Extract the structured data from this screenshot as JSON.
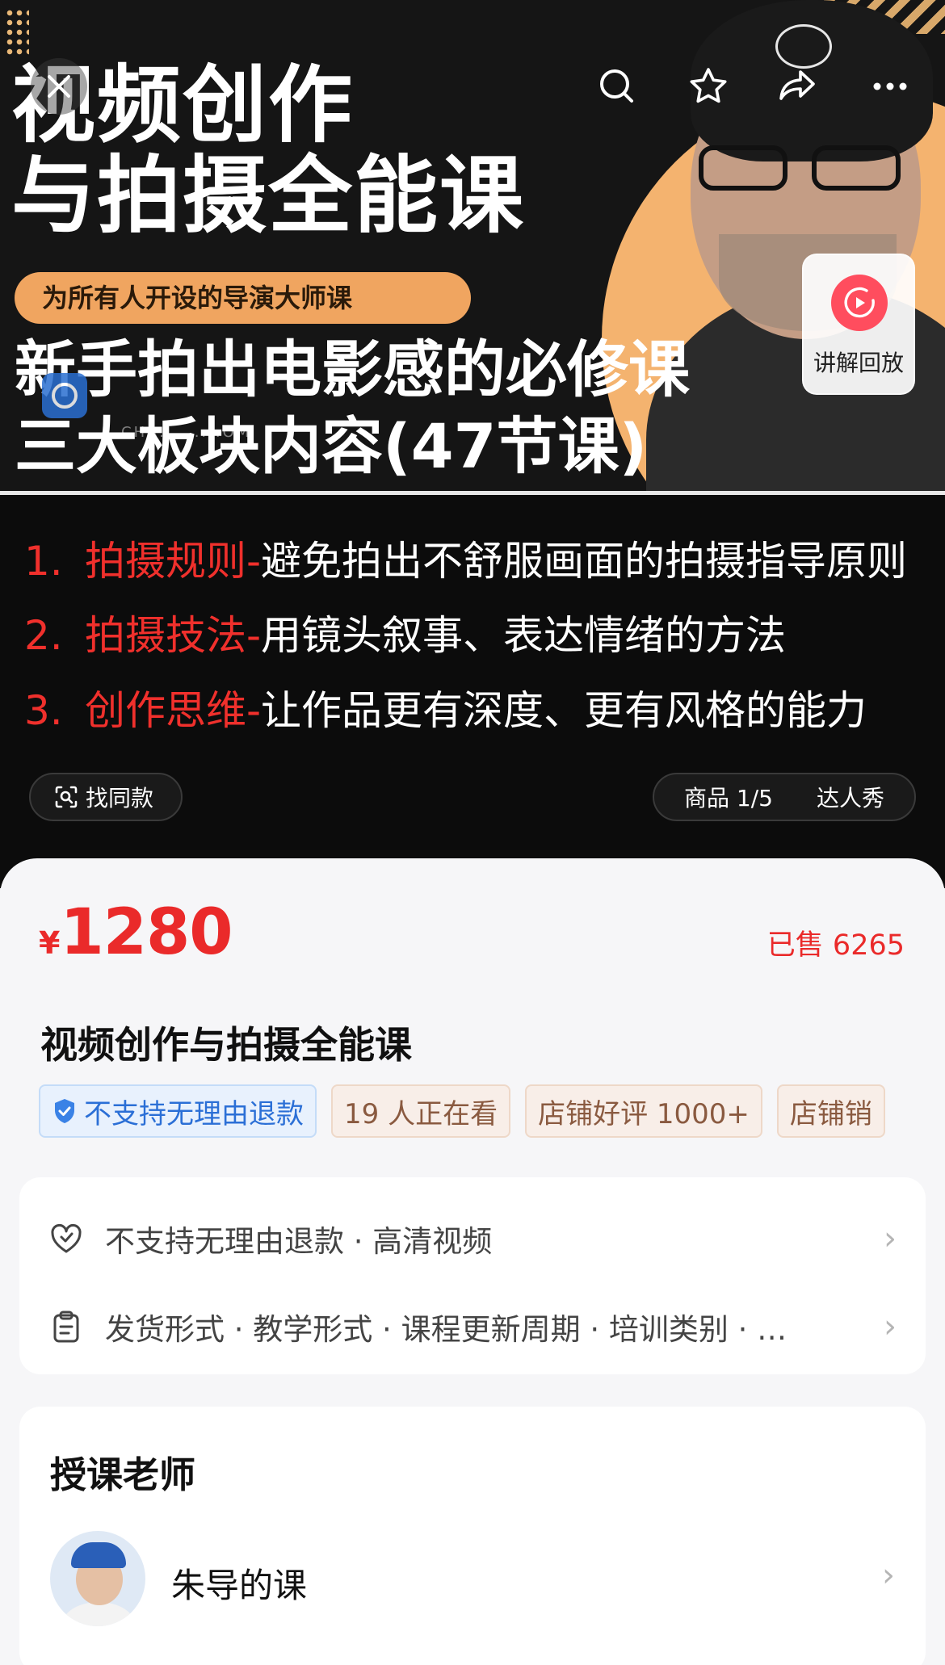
{
  "hero": {
    "title_line1": "视频创作",
    "title_line2": "与拍摄全能课",
    "subtitle": "为所有人开设的导演大师课",
    "headline_line1": "新手拍出电影感的必修课",
    "headline_line2": "三大板块内容(47节课)",
    "watermark_text": "CHA.........OM",
    "replay_label": "讲解回放",
    "features": [
      {
        "num": "1.",
        "key": "拍摄规则-",
        "desc": "避免拍出不舒服画面的拍摄指导原则"
      },
      {
        "num": "2.",
        "key": "拍摄技法-",
        "desc": "用镜头叙事、表达情绪的方法"
      },
      {
        "num": "3.",
        "key": "创作思维-",
        "desc": "让作品更有深度、更有风格的能力"
      }
    ],
    "find_same_label": "找同款",
    "goods_label": "商品 1/5",
    "talent_label": "达人秀"
  },
  "nav_icons": [
    "close-icon",
    "search-icon",
    "star-icon",
    "share-icon",
    "more-icon"
  ],
  "product": {
    "price_symbol": "¥",
    "price": "1280",
    "sold": "已售 6265",
    "title": "视频创作与拍摄全能课",
    "tags": [
      {
        "text": "不支持无理由退款",
        "style": "blue",
        "icon": "shield-check-icon"
      },
      {
        "text": "19 人正在看",
        "style": "tan"
      },
      {
        "text": "店铺好评 1000+",
        "style": "tan"
      },
      {
        "text": "店铺销",
        "style": "tan"
      }
    ],
    "info_rows": [
      {
        "icon": "heart-shield-icon",
        "text": "不支持无理由退款 · 高清视频"
      },
      {
        "icon": "clipboard-icon",
        "text": "发货形式 · 教学形式 · 课程更新周期 · 培训类别 · …"
      }
    ]
  },
  "teacher": {
    "heading": "授课老师",
    "name": "朱导的课"
  },
  "colors": {
    "accent_red": "#ea2a2a",
    "feature_red": "#f0302c",
    "banner_orange": "#f4b36f",
    "tag_blue": "#2b6fd6"
  }
}
